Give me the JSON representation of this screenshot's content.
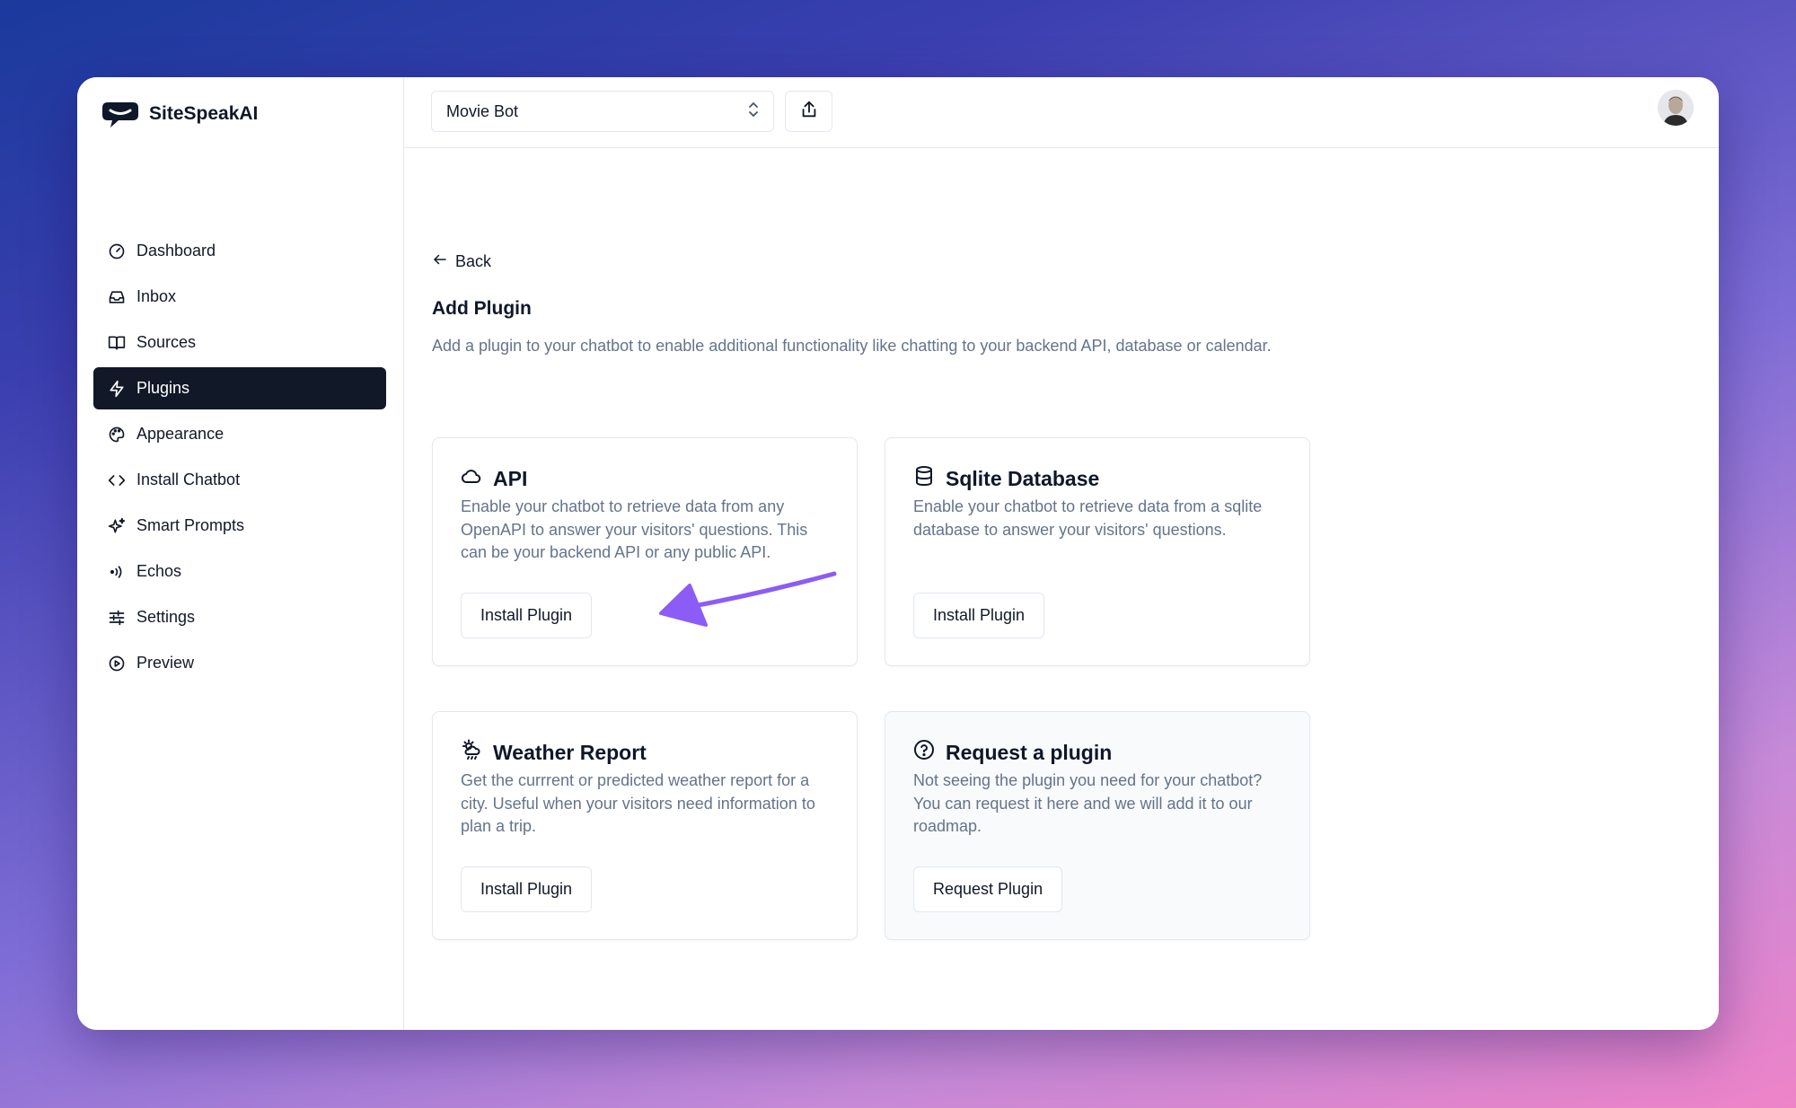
{
  "brand": {
    "name": "SiteSpeakAI",
    "logo_icon": "speech-bubble-logo"
  },
  "sidebar": {
    "items": [
      {
        "label": "Dashboard",
        "icon": "gauge-icon",
        "active": false
      },
      {
        "label": "Inbox",
        "icon": "inbox-icon",
        "active": false
      },
      {
        "label": "Sources",
        "icon": "book-icon",
        "active": false
      },
      {
        "label": "Plugins",
        "icon": "bolt-icon",
        "active": true
      },
      {
        "label": "Appearance",
        "icon": "palette-icon",
        "active": false
      },
      {
        "label": "Install Chatbot",
        "icon": "code-icon",
        "active": false
      },
      {
        "label": "Smart Prompts",
        "icon": "sparkles-icon",
        "active": false
      },
      {
        "label": "Echos",
        "icon": "broadcast-icon",
        "active": false
      },
      {
        "label": "Settings",
        "icon": "sliders-icon",
        "active": false
      },
      {
        "label": "Preview",
        "icon": "play-circle-icon",
        "active": false
      }
    ]
  },
  "topbar": {
    "bot_select": {
      "value": "Movie Bot",
      "icon": "chevrons-up-down-icon"
    },
    "share_icon": "share-icon",
    "avatar_icon": "user-avatar"
  },
  "main": {
    "back_label": "Back",
    "title": "Add Plugin",
    "description": "Add a plugin to your chatbot to enable additional functionality like chatting to your backend API, database or calendar."
  },
  "plugins": [
    {
      "title": "API",
      "icon": "cloud-icon",
      "description": "Enable your chatbot to retrieve data from any OpenAPI to answer your visitors' questions. This can be your backend API or any public API.",
      "button": "Install Plugin"
    },
    {
      "title": "Sqlite Database",
      "icon": "database-icon",
      "description": "Enable your chatbot to retrieve data from a sqlite database to answer your visitors' questions.",
      "button": "Install Plugin"
    },
    {
      "title": "Weather Report",
      "icon": "weather-icon",
      "description": "Get the currrent or predicted weather report for a city. Useful when your visitors need information to plan a trip.",
      "button": "Install Plugin"
    },
    {
      "title": "Request a plugin",
      "icon": "help-circle-icon",
      "description": "Not seeing the plugin you need for your chatbot? You can request it here and we will add it to our roadmap.",
      "button": "Request Plugin"
    }
  ],
  "colors": {
    "accent_arrow": "#8b5cf6",
    "active_nav_bg": "#111827",
    "muted_text": "#64748b"
  }
}
